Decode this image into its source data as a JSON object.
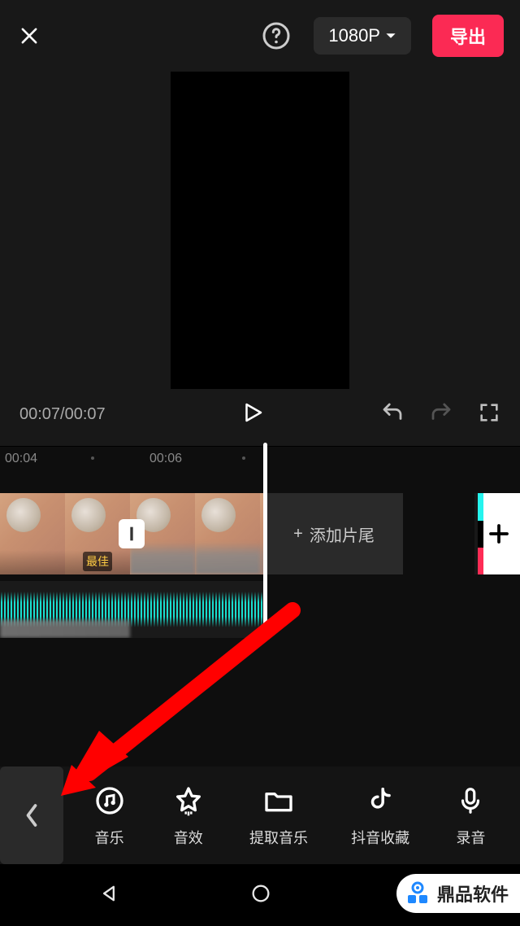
{
  "header": {
    "resolution": "1080P",
    "export_label": "导出"
  },
  "playback": {
    "current_time": "00:07",
    "total_time": "00:07",
    "display": "00:07/00:07"
  },
  "ruler": {
    "labels": [
      "00:04",
      "00:06"
    ]
  },
  "timeline": {
    "subtitle_badge": "最佳",
    "add_tail_label": "添加片尾",
    "add_media_label": "+"
  },
  "toolbar": {
    "items": [
      {
        "icon": "music-icon",
        "label": "音乐"
      },
      {
        "icon": "star-icon",
        "label": "音效"
      },
      {
        "icon": "folder-icon",
        "label": "提取音乐"
      },
      {
        "icon": "douyin-icon",
        "label": "抖音收藏"
      },
      {
        "icon": "mic-icon",
        "label": "录音"
      }
    ]
  },
  "watermark": {
    "text": "鼎品软件"
  }
}
